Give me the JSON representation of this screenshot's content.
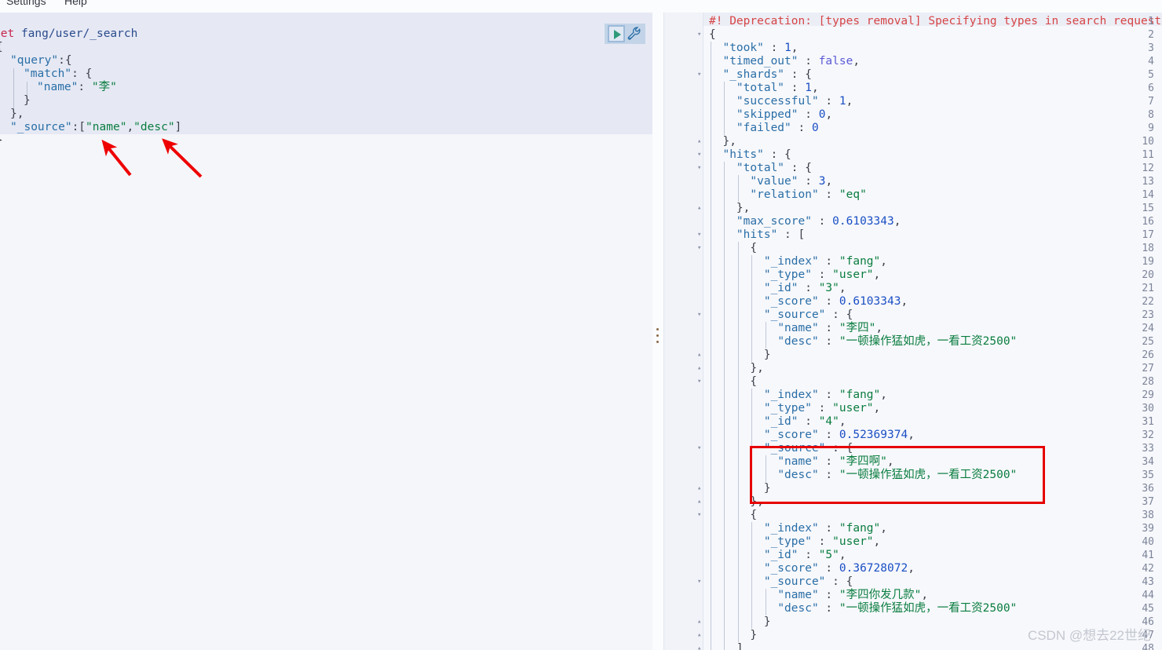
{
  "menubar": {
    "settings_label": "Settings",
    "help_label": "Help"
  },
  "controls": {
    "play_title": "Click to send request",
    "wrench_title": "Open documentation"
  },
  "request": {
    "method": "get",
    "path": "fang/user/_search",
    "lines": [
      "{",
      "  \"query\":{",
      "    \"match\": {",
      "      \"name\": \"李\"",
      "    }",
      "  },",
      "  \"_source\":[\"name\",\"desc\"]",
      "}"
    ],
    "body_tokens": {
      "query_key": "\"query\"",
      "match_key": "\"match\"",
      "name_key": "\"name\"",
      "name_value": "\"李\"",
      "source_key": "\"_source\"",
      "source_value_1": "\"name\"",
      "source_value_2": "\"desc\""
    }
  },
  "annotations": {
    "arrow_count": 2,
    "arrow_color": "#ee0000",
    "highlight_box_color": "#e60000"
  },
  "response": {
    "warning_line": "#! Deprecation: [types removal] Specifying types in search requests is deprec",
    "lines": [
      {
        "n": 1,
        "fold": "",
        "text": "#! Deprecation: [types removal] Specifying types in search requests is deprec",
        "kind": "warn"
      },
      {
        "n": 2,
        "fold": "▾",
        "text": "{",
        "kind": "punct"
      },
      {
        "n": 3,
        "fold": "",
        "text": "  \"took\" : 1,",
        "kind": "kv-num"
      },
      {
        "n": 4,
        "fold": "",
        "text": "  \"timed_out\" : false,",
        "kind": "kv-bool"
      },
      {
        "n": 5,
        "fold": "▾",
        "text": "  \"_shards\" : {",
        "kind": "kv-obj"
      },
      {
        "n": 6,
        "fold": "",
        "text": "    \"total\" : 1,",
        "kind": "kv-num"
      },
      {
        "n": 7,
        "fold": "",
        "text": "    \"successful\" : 1,",
        "kind": "kv-num"
      },
      {
        "n": 8,
        "fold": "",
        "text": "    \"skipped\" : 0,",
        "kind": "kv-num"
      },
      {
        "n": 9,
        "fold": "",
        "text": "    \"failed\" : 0",
        "kind": "kv-num"
      },
      {
        "n": 10,
        "fold": "▴",
        "text": "  },",
        "kind": "punct"
      },
      {
        "n": 11,
        "fold": "▾",
        "text": "  \"hits\" : {",
        "kind": "kv-obj"
      },
      {
        "n": 12,
        "fold": "▾",
        "text": "    \"total\" : {",
        "kind": "kv-obj"
      },
      {
        "n": 13,
        "fold": "",
        "text": "      \"value\" : 3,",
        "kind": "kv-num"
      },
      {
        "n": 14,
        "fold": "",
        "text": "      \"relation\" : \"eq\"",
        "kind": "kv-str"
      },
      {
        "n": 15,
        "fold": "▴",
        "text": "    },",
        "kind": "punct"
      },
      {
        "n": 16,
        "fold": "",
        "text": "    \"max_score\" : 0.6103343,",
        "kind": "kv-num"
      },
      {
        "n": 17,
        "fold": "▾",
        "text": "    \"hits\" : [",
        "kind": "kv-obj"
      },
      {
        "n": 18,
        "fold": "▾",
        "text": "      {",
        "kind": "punct"
      },
      {
        "n": 19,
        "fold": "",
        "text": "        \"_index\" : \"fang\",",
        "kind": "kv-str"
      },
      {
        "n": 20,
        "fold": "",
        "text": "        \"_type\" : \"user\",",
        "kind": "kv-str"
      },
      {
        "n": 21,
        "fold": "",
        "text": "        \"_id\" : \"3\",",
        "kind": "kv-str"
      },
      {
        "n": 22,
        "fold": "",
        "text": "        \"_score\" : 0.6103343,",
        "kind": "kv-num"
      },
      {
        "n": 23,
        "fold": "▾",
        "text": "        \"_source\" : {",
        "kind": "kv-obj"
      },
      {
        "n": 24,
        "fold": "",
        "text": "          \"name\" : \"李四\",",
        "kind": "kv-str"
      },
      {
        "n": 25,
        "fold": "",
        "text": "          \"desc\" : \"一顿操作猛如虎，一看工资2500\"",
        "kind": "kv-str"
      },
      {
        "n": 26,
        "fold": "▴",
        "text": "        }",
        "kind": "punct"
      },
      {
        "n": 27,
        "fold": "▴",
        "text": "      },",
        "kind": "punct"
      },
      {
        "n": 28,
        "fold": "▾",
        "text": "      {",
        "kind": "punct"
      },
      {
        "n": 29,
        "fold": "",
        "text": "        \"_index\" : \"fang\",",
        "kind": "kv-str"
      },
      {
        "n": 30,
        "fold": "",
        "text": "        \"_type\" : \"user\",",
        "kind": "kv-str"
      },
      {
        "n": 31,
        "fold": "",
        "text": "        \"_id\" : \"4\",",
        "kind": "kv-str"
      },
      {
        "n": 32,
        "fold": "",
        "text": "        \"_score\" : 0.52369374,",
        "kind": "kv-num"
      },
      {
        "n": 33,
        "fold": "▾",
        "text": "        \"_source\" : {",
        "kind": "kv-obj"
      },
      {
        "n": 34,
        "fold": "",
        "text": "          \"name\" : \"李四啊\",",
        "kind": "kv-str"
      },
      {
        "n": 35,
        "fold": "",
        "text": "          \"desc\" : \"一顿操作猛如虎，一看工资2500\"",
        "kind": "kv-str"
      },
      {
        "n": 36,
        "fold": "▴",
        "text": "        }",
        "kind": "punct"
      },
      {
        "n": 37,
        "fold": "▴",
        "text": "      },",
        "kind": "punct"
      },
      {
        "n": 38,
        "fold": "▾",
        "text": "      {",
        "kind": "punct"
      },
      {
        "n": 39,
        "fold": "",
        "text": "        \"_index\" : \"fang\",",
        "kind": "kv-str"
      },
      {
        "n": 40,
        "fold": "",
        "text": "        \"_type\" : \"user\",",
        "kind": "kv-str"
      },
      {
        "n": 41,
        "fold": "",
        "text": "        \"_id\" : \"5\",",
        "kind": "kv-str"
      },
      {
        "n": 42,
        "fold": "",
        "text": "        \"_score\" : 0.36728072,",
        "kind": "kv-num"
      },
      {
        "n": 43,
        "fold": "▾",
        "text": "        \"_source\" : {",
        "kind": "kv-obj"
      },
      {
        "n": 44,
        "fold": "",
        "text": "          \"name\" : \"李四你发几款\",",
        "kind": "kv-str"
      },
      {
        "n": 45,
        "fold": "",
        "text": "          \"desc\" : \"一顿操作猛如虎，一看工资2500\"",
        "kind": "kv-str"
      },
      {
        "n": 46,
        "fold": "▴",
        "text": "        }",
        "kind": "punct"
      },
      {
        "n": 47,
        "fold": "▴",
        "text": "      }",
        "kind": "punct"
      },
      {
        "n": 48,
        "fold": "▴",
        "text": "    ]",
        "kind": "punct"
      }
    ],
    "parsed": {
      "took": 1,
      "timed_out": false,
      "_shards": {
        "total": 1,
        "successful": 1,
        "skipped": 0,
        "failed": 0
      },
      "hits": {
        "total": {
          "value": 3,
          "relation": "eq"
        },
        "max_score": 0.6103343,
        "hits": [
          {
            "_index": "fang",
            "_type": "user",
            "_id": "3",
            "_score": 0.6103343,
            "_source": {
              "name": "李四",
              "desc": "一顿操作猛如虎，一看工资2500"
            }
          },
          {
            "_index": "fang",
            "_type": "user",
            "_id": "4",
            "_score": 0.52369374,
            "_source": {
              "name": "李四啊",
              "desc": "一顿操作猛如虎，一看工资2500"
            }
          },
          {
            "_index": "fang",
            "_type": "user",
            "_id": "5",
            "_score": 0.36728072,
            "_source": {
              "name": "李四你发几款",
              "desc": "一顿操作猛如虎，一看工资2500"
            }
          }
        ]
      }
    }
  },
  "watermark": {
    "text": "CSDN @想去22世纪"
  },
  "colors": {
    "editor_bg": "#e6e9f4",
    "pane_bg": "#f5f6fa",
    "response_bg": "#f7f8fc",
    "gutter_bg": "#f1f3f9",
    "string": "#0a7d3f",
    "key": "#2a6ea6",
    "number": "#1a4fc4",
    "boolean": "#5b5bd6",
    "method": "#c7254e",
    "warning": "#d64545",
    "annotation_red": "#e60000"
  }
}
